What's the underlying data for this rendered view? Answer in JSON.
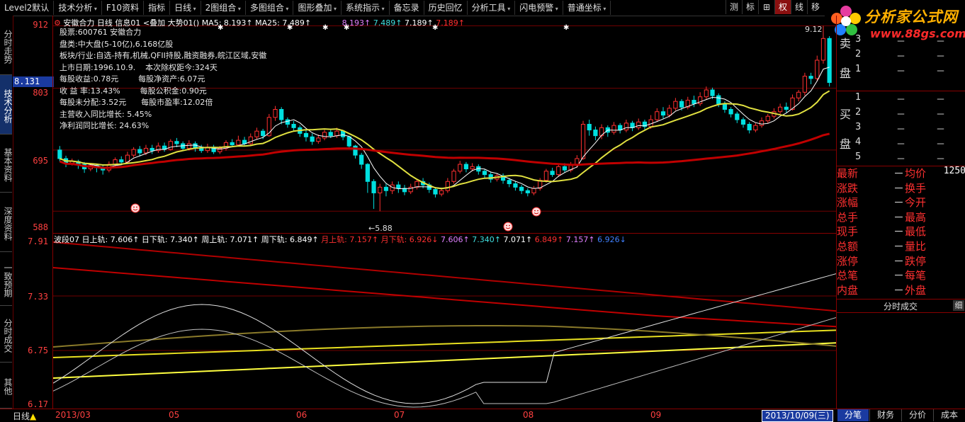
{
  "toolbar": {
    "items": [
      "Level2默认",
      "技术分析",
      "F10资料",
      "指标",
      "日线",
      "2图组合",
      "多图组合",
      "图形叠加",
      "系统指示",
      "备忘录",
      "历史回忆",
      "分析工具",
      "闪电预警",
      "普通坐标"
    ],
    "right_buttons": [
      "测",
      "标",
      "⊞",
      "权",
      "线",
      "移"
    ],
    "active_right": "权"
  },
  "logo": {
    "title": "分析家公式网",
    "url": "www.88gs.com"
  },
  "left_tabs": [
    "分时走势",
    "技术分析",
    "基本资料",
    "深度资料",
    "一致预期",
    "分时成交",
    "其他"
  ],
  "left_active": "技术分析",
  "main_chart": {
    "header": {
      "name": "安徽合力",
      "period": "日线",
      "info_tag": "信息01",
      "overlay": "<叠加",
      "trend": "大势01()",
      "ma5_label": "MA5: 8.193↑",
      "ma25_label": "MA25: 7.489↑",
      "extra_values": [
        "8.193↑",
        "7.489↑",
        "7.189↑",
        "7.189↑"
      ]
    },
    "y_labels": [
      "912",
      "803",
      "695",
      "588"
    ],
    "current_price": "8.131",
    "high_mark": "9.12",
    "low_mark": "5.88",
    "info_lines": [
      "股票:600761 安徽合力",
      "盘类:中大盘(5-10亿),6.168亿股",
      "板块/行业:自选-持有,机械,QFII持股,融资融券,皖江区域,安徽",
      "上市日期:1996.10.9.    本次除权距今:324天",
      "每股收益:0.78元        每股净资产:6.07元",
      "收 益 率:13.43%        每股公积金:0.90元",
      "每股未分配:3.52元      每股市盈率:12.02倍",
      "主营收入同比增长: 5.45%",
      "净利润同比增长: 24.63%"
    ]
  },
  "sub_chart": {
    "header": {
      "name": "波段07",
      "d_up": "日上轨: 7.606↑",
      "d_dn": "日下轨: 7.340↑",
      "w_up": "周上轨: 7.071↑",
      "w_dn": "周下轨: 6.849↑",
      "m_up": "月上轨: 7.157↑",
      "m_dn": "月下轨: 6.926↓",
      "vals": [
        "7.606↑",
        "7.340↑",
        "7.071↑",
        "6.849↑",
        "7.157↑",
        "6.926↓"
      ]
    },
    "y_labels": [
      "7.91",
      "7.33",
      "6.75",
      "6.17"
    ]
  },
  "right_panel": {
    "sell_label": [
      "卖",
      "盘"
    ],
    "sell_levels": [
      "3",
      "2",
      "1"
    ],
    "buy_label": [
      "买",
      "盘"
    ],
    "buy_levels": [
      "1",
      "2",
      "3",
      "4",
      "5"
    ],
    "dash": "－",
    "quote_rows": [
      [
        "最新",
        "均价"
      ],
      [
        "涨跌",
        "换手"
      ],
      [
        "涨幅",
        "今开"
      ],
      [
        "总手",
        "最高"
      ],
      [
        "现手",
        "最低"
      ],
      [
        "总额",
        "量比"
      ],
      [
        "涨停",
        "跌停"
      ],
      [
        "总笔",
        "每笔"
      ],
      [
        "内盘",
        "外盘"
      ]
    ],
    "volume_value": "1250",
    "tick_header": "分时成交",
    "tick_button": "细"
  },
  "bottom": {
    "period_tab": "日线",
    "x_labels": [
      "2013/03",
      "05",
      "06",
      "07",
      "08",
      "09"
    ],
    "date_box": "2013/10/09(三)",
    "tabs": [
      "分笔",
      "财务",
      "分价",
      "成本"
    ],
    "active_tab": "分笔"
  },
  "colors": {
    "up": "#ff3030",
    "down": "#00e0e0",
    "ma5": "#ffffff",
    "ma25": "#e0e040",
    "long_ma": "#c00000",
    "grid": "#800000"
  },
  "chart_data": {
    "type": "candlestick",
    "ylim": [
      5.5,
      9.3
    ],
    "candles": [
      [
        6.95,
        6.8,
        7.02,
        6.75
      ],
      [
        6.8,
        6.72,
        6.85,
        6.65
      ],
      [
        6.72,
        6.75,
        6.8,
        6.68
      ],
      [
        6.75,
        6.7,
        6.78,
        6.62
      ],
      [
        6.7,
        6.62,
        6.74,
        6.55
      ],
      [
        6.62,
        6.68,
        6.72,
        6.58
      ],
      [
        6.68,
        6.64,
        6.7,
        6.56
      ],
      [
        6.64,
        6.6,
        6.68,
        6.52
      ],
      [
        6.6,
        6.7,
        6.75,
        6.56
      ],
      [
        6.7,
        6.78,
        6.82,
        6.66
      ],
      [
        6.78,
        6.74,
        6.84,
        6.7
      ],
      [
        6.74,
        6.86,
        6.92,
        6.72
      ],
      [
        6.86,
        6.96,
        7.0,
        6.82
      ],
      [
        6.96,
        6.9,
        7.02,
        6.84
      ],
      [
        6.9,
        6.98,
        7.04,
        6.86
      ],
      [
        6.98,
        6.94,
        7.04,
        6.88
      ],
      [
        6.94,
        7.02,
        7.08,
        6.9
      ],
      [
        7.02,
        6.96,
        7.08,
        6.92
      ],
      [
        6.96,
        7.1,
        7.14,
        6.94
      ],
      [
        7.1,
        7.06,
        7.16,
        7.0
      ],
      [
        7.06,
        6.98,
        7.1,
        6.94
      ],
      [
        6.98,
        7.06,
        7.12,
        6.94
      ],
      [
        7.06,
        6.98,
        7.1,
        6.92
      ],
      [
        6.98,
        6.94,
        7.04,
        6.9
      ],
      [
        6.94,
        7.0,
        7.06,
        6.9
      ],
      [
        7.0,
        6.92,
        7.04,
        6.88
      ],
      [
        6.92,
        6.98,
        7.02,
        6.88
      ],
      [
        6.98,
        7.08,
        7.12,
        6.94
      ],
      [
        7.08,
        7.04,
        7.14,
        7.0
      ],
      [
        7.04,
        7.12,
        7.2,
        7.02
      ],
      [
        7.12,
        7.06,
        7.18,
        7.02
      ],
      [
        7.06,
        7.18,
        7.24,
        7.04
      ],
      [
        7.18,
        7.28,
        7.34,
        7.14
      ],
      [
        7.28,
        7.2,
        7.32,
        7.14
      ],
      [
        7.2,
        7.52,
        7.58,
        7.18
      ],
      [
        7.52,
        7.66,
        7.72,
        7.46
      ],
      [
        7.66,
        7.48,
        7.7,
        7.4
      ],
      [
        7.48,
        7.4,
        7.52,
        7.34
      ],
      [
        7.4,
        7.34,
        7.46,
        7.28
      ],
      [
        7.34,
        7.24,
        7.38,
        7.18
      ],
      [
        7.24,
        7.18,
        7.3,
        7.1
      ],
      [
        7.18,
        7.1,
        7.24,
        7.04
      ],
      [
        7.1,
        7.16,
        7.22,
        7.06
      ],
      [
        7.16,
        7.26,
        7.3,
        7.12
      ],
      [
        7.26,
        7.2,
        7.32,
        7.16
      ],
      [
        7.2,
        7.28,
        7.34,
        7.16
      ],
      [
        7.28,
        7.18,
        7.3,
        7.12
      ],
      [
        7.18,
        7.02,
        7.2,
        6.96
      ],
      [
        7.02,
        6.86,
        7.04,
        6.8
      ],
      [
        6.86,
        6.7,
        6.9,
        6.62
      ],
      [
        6.7,
        6.4,
        6.72,
        6.2
      ],
      [
        6.4,
        6.2,
        6.44,
        5.92
      ],
      [
        6.2,
        6.3,
        6.36,
        5.88
      ],
      [
        6.3,
        6.24,
        6.36,
        6.14
      ],
      [
        6.24,
        6.34,
        6.4,
        6.18
      ],
      [
        6.34,
        6.28,
        6.4,
        6.2
      ],
      [
        6.28,
        6.22,
        6.34,
        6.16
      ],
      [
        6.22,
        6.3,
        6.36,
        6.18
      ],
      [
        6.3,
        6.4,
        6.44,
        6.26
      ],
      [
        6.4,
        6.34,
        6.46,
        6.28
      ],
      [
        6.34,
        6.26,
        6.38,
        6.2
      ],
      [
        6.26,
        6.18,
        6.3,
        6.12
      ],
      [
        6.18,
        6.24,
        6.28,
        6.14
      ],
      [
        6.24,
        6.4,
        6.46,
        6.2
      ],
      [
        6.4,
        6.58,
        6.62,
        6.36
      ],
      [
        6.58,
        6.7,
        6.76,
        6.54
      ],
      [
        6.7,
        6.62,
        6.74,
        6.56
      ],
      [
        6.62,
        6.66,
        6.72,
        6.58
      ],
      [
        6.66,
        6.58,
        6.7,
        6.52
      ],
      [
        6.58,
        6.52,
        6.62,
        6.46
      ],
      [
        6.52,
        6.44,
        6.56,
        6.38
      ],
      [
        6.44,
        6.5,
        6.54,
        6.4
      ],
      [
        6.5,
        6.42,
        6.54,
        6.36
      ],
      [
        6.42,
        6.36,
        6.46,
        6.3
      ],
      [
        6.36,
        6.3,
        6.4,
        6.24
      ],
      [
        6.3,
        6.24,
        6.34,
        6.18
      ],
      [
        6.24,
        6.2,
        6.28,
        6.14
      ],
      [
        6.2,
        6.28,
        6.32,
        6.16
      ],
      [
        6.28,
        6.42,
        6.46,
        6.24
      ],
      [
        6.42,
        6.58,
        6.62,
        6.38
      ],
      [
        6.58,
        6.52,
        6.64,
        6.48
      ],
      [
        6.52,
        6.66,
        6.7,
        6.48
      ],
      [
        6.66,
        6.6,
        6.72,
        6.56
      ],
      [
        6.6,
        6.68,
        6.74,
        6.56
      ],
      [
        6.68,
        6.8,
        6.86,
        6.64
      ],
      [
        6.8,
        7.4,
        7.46,
        6.78
      ],
      [
        7.4,
        7.3,
        7.48,
        7.2
      ],
      [
        7.3,
        7.2,
        7.36,
        7.12
      ],
      [
        7.2,
        7.34,
        7.4,
        7.14
      ],
      [
        7.34,
        7.26,
        7.38,
        7.18
      ],
      [
        7.26,
        7.38,
        7.44,
        7.22
      ],
      [
        7.38,
        7.3,
        7.42,
        7.24
      ],
      [
        7.3,
        7.42,
        7.48,
        7.26
      ],
      [
        7.42,
        7.34,
        7.46,
        7.28
      ],
      [
        7.34,
        7.44,
        7.5,
        7.3
      ],
      [
        7.44,
        7.36,
        7.48,
        7.3
      ],
      [
        7.36,
        7.48,
        7.56,
        7.32
      ],
      [
        7.48,
        7.62,
        7.68,
        7.44
      ],
      [
        7.62,
        7.56,
        7.7,
        7.5
      ],
      [
        7.56,
        7.68,
        7.74,
        7.52
      ],
      [
        7.68,
        7.8,
        7.86,
        7.64
      ],
      [
        7.8,
        7.7,
        7.84,
        7.64
      ],
      [
        7.7,
        7.82,
        7.88,
        7.66
      ],
      [
        7.82,
        7.76,
        7.9,
        7.7
      ],
      [
        7.76,
        7.88,
        7.96,
        7.72
      ],
      [
        7.88,
        8.0,
        8.06,
        7.84
      ],
      [
        8.0,
        7.9,
        8.04,
        7.84
      ],
      [
        7.9,
        7.76,
        7.94,
        7.7
      ],
      [
        7.76,
        7.66,
        7.8,
        7.6
      ],
      [
        7.66,
        7.58,
        7.7,
        7.52
      ],
      [
        7.58,
        7.48,
        7.62,
        7.42
      ],
      [
        7.48,
        7.4,
        7.52,
        7.34
      ],
      [
        7.4,
        7.3,
        7.44,
        7.24
      ],
      [
        7.3,
        7.38,
        7.42,
        7.26
      ],
      [
        7.38,
        7.46,
        7.52,
        7.34
      ],
      [
        7.46,
        7.54,
        7.58,
        7.42
      ],
      [
        7.54,
        7.62,
        7.68,
        7.5
      ],
      [
        7.62,
        7.7,
        7.76,
        7.58
      ],
      [
        7.7,
        7.66,
        7.78,
        7.6
      ],
      [
        7.66,
        7.86,
        7.92,
        7.64
      ],
      [
        7.86,
        7.96,
        8.0,
        7.8
      ],
      [
        7.96,
        8.24,
        8.3,
        7.9
      ],
      [
        8.24,
        8.2,
        8.3,
        8.1
      ],
      [
        8.2,
        8.52,
        8.6,
        8.16
      ],
      [
        8.52,
        8.9,
        9.12,
        8.46
      ],
      [
        8.9,
        8.13,
        8.94,
        8.06
      ]
    ]
  }
}
